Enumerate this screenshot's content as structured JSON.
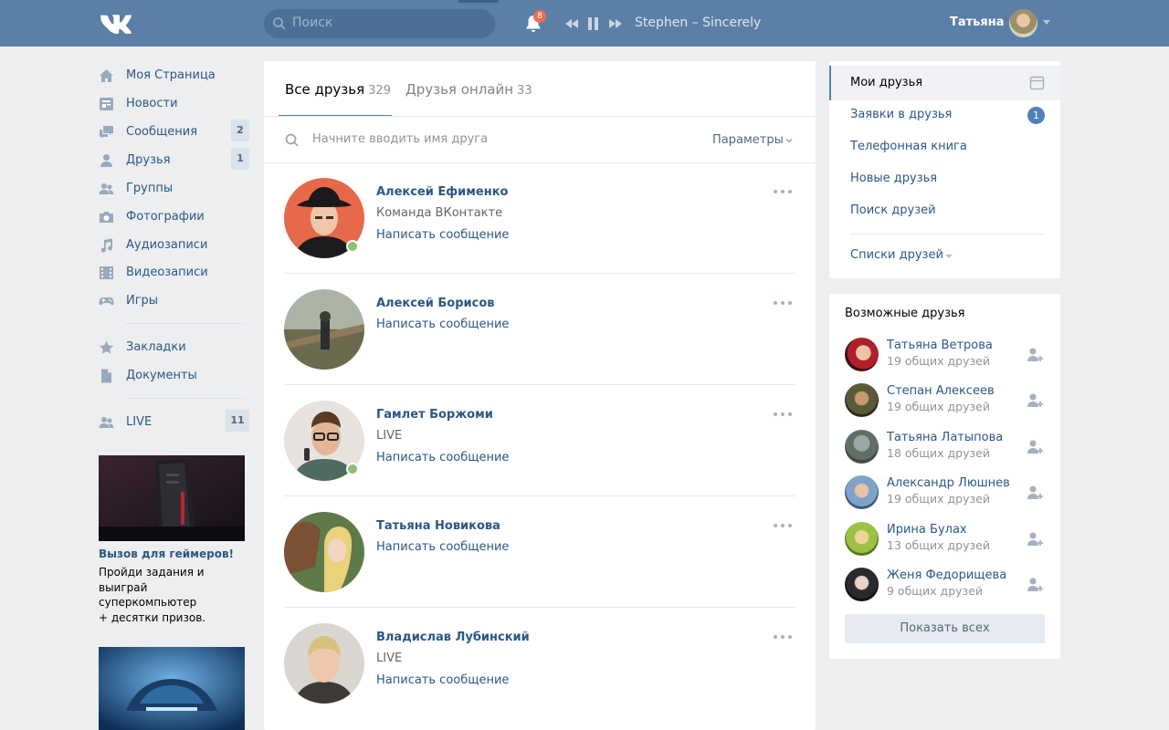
{
  "header": {
    "search_placeholder": "Поиск",
    "notifications_count": "8",
    "track": "Stephen – Sincerely",
    "user_name": "Татьяна",
    "icons": [
      "vk-logo-icon",
      "search-icon",
      "bell-icon",
      "prev-icon",
      "pause-icon",
      "next-icon",
      "chevron-down-icon"
    ]
  },
  "sidebar": {
    "items": [
      {
        "label": "Моя Страница",
        "icon": "home-icon"
      },
      {
        "label": "Новости",
        "icon": "news-icon"
      },
      {
        "label": "Сообщения",
        "icon": "messages-icon",
        "count": "2"
      },
      {
        "label": "Друзья",
        "icon": "friends-icon",
        "count": "1"
      },
      {
        "label": "Группы",
        "icon": "groups-icon"
      },
      {
        "label": "Фотографии",
        "icon": "camera-icon"
      },
      {
        "label": "Аудиозаписи",
        "icon": "music-icon"
      },
      {
        "label": "Видеозаписи",
        "icon": "film-icon"
      },
      {
        "label": "Игры",
        "icon": "gamepad-icon"
      },
      {
        "label": "Закладки",
        "icon": "star-icon"
      },
      {
        "label": "Документы",
        "icon": "document-icon"
      },
      {
        "label": "LIVE",
        "icon": "live-icon",
        "count": "11"
      }
    ],
    "ad1": {
      "title": "Вызов для геймеров!",
      "lines": [
        "Пройди задания и",
        "выиграй",
        "суперкомпьютер",
        "+ десятки призов."
      ]
    }
  },
  "main": {
    "tabs": [
      {
        "label": "Все друзья",
        "count": "329"
      },
      {
        "label": "Друзья онлайн",
        "count": "33"
      }
    ],
    "search_placeholder": "Начните вводить имя друга",
    "params_label": "Параметры",
    "friends": [
      {
        "name": "Алексей Ефименко",
        "sub": "Команда ВКонтакте",
        "msg": "Написать сообщение",
        "online": true
      },
      {
        "name": "Алексей Борисов",
        "sub": "",
        "msg": "Написать сообщение",
        "online": false
      },
      {
        "name": "Гамлет Боржоми",
        "sub": "LIVE",
        "msg": "Написать сообщение",
        "online": true
      },
      {
        "name": "Татьяна Новикова",
        "sub": "",
        "msg": "Написать сообщение",
        "online": false
      },
      {
        "name": "Владислав Лубинский",
        "sub": "LIVE",
        "msg": "Написать сообщение",
        "online": false
      }
    ]
  },
  "right_menu": {
    "items": [
      "Мои друзья",
      "Заявки в друзья",
      "Телефонная книга",
      "Новые друзья",
      "Поиск друзей"
    ],
    "requests_count": "1",
    "lists_label": "Списки друзей"
  },
  "possible_friends": {
    "title": "Возможные друзья",
    "people": [
      {
        "name": "Татьяна Ветрова",
        "mutual": "19 общих друзей"
      },
      {
        "name": "Степан Алексеев",
        "mutual": "19 общих друзей"
      },
      {
        "name": "Татьяна Латыпова",
        "mutual": "18 общих друзей"
      },
      {
        "name": "Александр Люшнев",
        "mutual": "19 общих друзей"
      },
      {
        "name": "Ирина Булах",
        "mutual": "13 общих друзей"
      },
      {
        "name": "Женя Федорищева",
        "mutual": "9 общих друзей"
      }
    ],
    "show_all": "Показать всех"
  },
  "colors": {
    "header": "#5b7fa6",
    "link": "#2a5885",
    "accent": "#5181b8",
    "online": "#8ac176",
    "badge": "#ef6d50"
  }
}
